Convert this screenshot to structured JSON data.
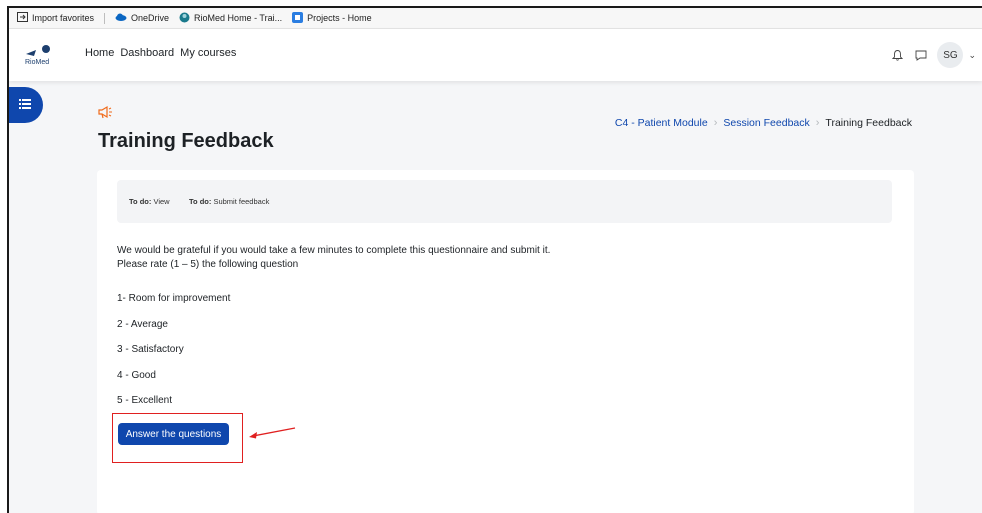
{
  "favorites": [
    {
      "label": "Import favorites",
      "icon": "import-icon"
    },
    {
      "label": "OneDrive",
      "icon": "cloud-icon"
    },
    {
      "label": "RioMed Home - Trai...",
      "icon": "riomed-favicon-icon"
    },
    {
      "label": "Projects - Home",
      "icon": "projects-icon"
    }
  ],
  "navbar": {
    "logo_text": "RioMed",
    "links": [
      "Home",
      "Dashboard",
      "My courses"
    ],
    "avatar_initials": "SG"
  },
  "page": {
    "title": "Training Feedback",
    "breadcrumb": [
      "C4 - Patient Module",
      "Session Feedback",
      "Training Feedback"
    ]
  },
  "todo": [
    {
      "label": "To do:",
      "value": "View"
    },
    {
      "label": "To do:",
      "value": "Submit feedback"
    }
  ],
  "intro": {
    "line1": "We would be grateful if you would take a few minutes to complete this questionnaire and submit it.",
    "line2": "Please rate (1 – 5) the following question"
  },
  "ratings": [
    "1- Room for improvement",
    "2 - Average",
    "3 - Satisfactory",
    "4 - Good",
    "5 - Excellent"
  ],
  "answer_button": "Answer the questions",
  "colors": {
    "primary": "#0f47ad",
    "accent_icon": "#f06a1a",
    "annotation": "#e02020"
  }
}
